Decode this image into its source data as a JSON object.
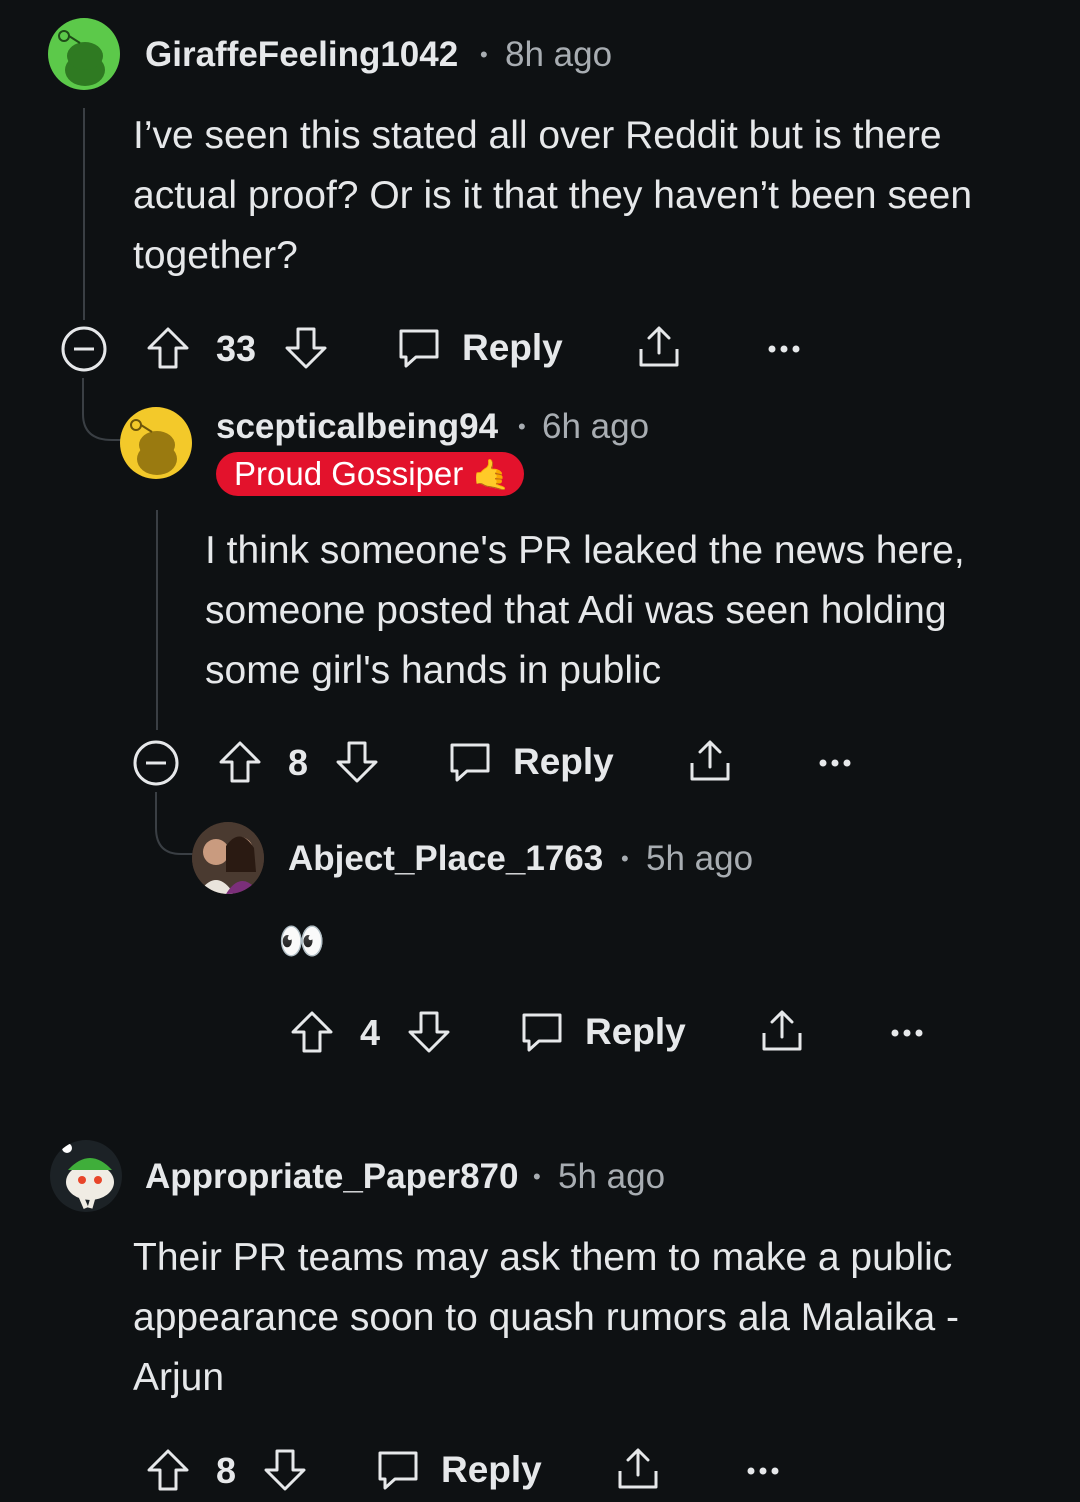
{
  "comments": [
    {
      "username": "GiraffeFeeling1042",
      "time": "8h ago",
      "body": "I’ve seen this stated all over Reddit but is there actual proof? Or is it that they haven’t been seen together?",
      "score": "33",
      "reply_label": "Reply"
    },
    {
      "username": "scepticalbeing94",
      "time": "6h ago",
      "flair": "Proud Gossiper",
      "flair_emoji": "🤙",
      "body": "I think someone's PR leaked the news here, someone posted that Adi was seen holding some girl's hands in public",
      "score": "8",
      "reply_label": "Reply"
    },
    {
      "username": "Abject_Place_1763",
      "time": "5h ago",
      "body": "👀",
      "score": "4",
      "reply_label": "Reply"
    },
    {
      "username": "Appropriate_Paper870",
      "time": "5h ago",
      "body": "Their PR teams may ask them to make a public appearance soon to quash rumors ala Malaika - Arjun",
      "score": "8",
      "reply_label": "Reply"
    }
  ],
  "separator": "•",
  "colors": {
    "background": "#0e1113",
    "text": "#e6e8ea",
    "muted": "#a8adb2",
    "flair_bg": "#e3122c",
    "avatar_green": "#5cc94a",
    "avatar_yellow": "#f3c92a"
  },
  "icons": [
    "collapse-icon",
    "upvote-icon",
    "downvote-icon",
    "comment-icon",
    "share-icon",
    "more-icon"
  ]
}
